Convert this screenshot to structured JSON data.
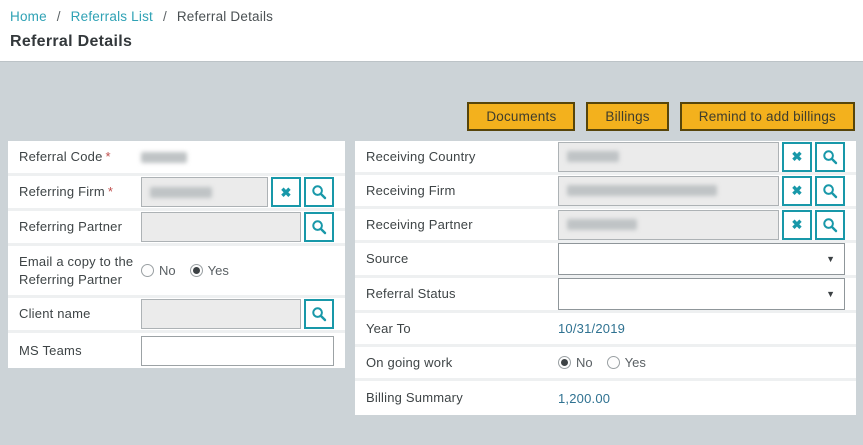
{
  "breadcrumb": {
    "separator": "/",
    "items": [
      {
        "label": "Home",
        "link": true
      },
      {
        "label": "Referrals List",
        "link": true
      },
      {
        "label": "Referral Details",
        "link": false
      }
    ]
  },
  "page": {
    "title": "Referral Details"
  },
  "toolbar": {
    "buttons": [
      {
        "label": "Documents"
      },
      {
        "label": "Billings"
      },
      {
        "label": "Remind to add billings"
      }
    ]
  },
  "marks": {
    "required": "*"
  },
  "icons": {
    "clear": "✖",
    "search": "magnifier",
    "dropdown": "▼"
  },
  "colors": {
    "accent_teal": "#1898a9",
    "link_teal": "#2fa2b5",
    "button_yellow": "#f3b11d",
    "value_blue": "#2f7291",
    "required_red": "#be4b49",
    "page_background": "#ccd3d7"
  },
  "form_left": {
    "fields": [
      {
        "label": "Referral Code",
        "required": true,
        "value": "",
        "value_obscured": true,
        "type": "readonly"
      },
      {
        "label": "Referring Firm",
        "required": true,
        "value": "",
        "value_obscured": true,
        "type": "lookup",
        "actions": [
          "clear",
          "search"
        ]
      },
      {
        "label": "Referring Partner",
        "value": "",
        "value_obscured": false,
        "type": "lookup",
        "actions": [
          "search"
        ]
      },
      {
        "label": "Email a copy to the Referring Partner",
        "type": "radio",
        "options": [
          "No",
          "Yes"
        ],
        "selected": "Yes"
      },
      {
        "label": "Client name",
        "value": "",
        "value_obscured": false,
        "type": "lookup",
        "actions": [
          "search"
        ]
      },
      {
        "label": "MS Teams",
        "value": "",
        "type": "text"
      }
    ]
  },
  "form_right": {
    "fields": [
      {
        "label": "Receiving Country",
        "value": "",
        "value_obscured": true,
        "type": "lookup",
        "actions": [
          "clear",
          "search"
        ]
      },
      {
        "label": "Receiving Firm",
        "value": "",
        "value_obscured": true,
        "type": "lookup",
        "actions": [
          "clear",
          "search"
        ]
      },
      {
        "label": "Receiving Partner",
        "value": "",
        "value_obscured": true,
        "type": "lookup",
        "actions": [
          "clear",
          "search"
        ]
      },
      {
        "label": "Source",
        "value": "",
        "type": "select"
      },
      {
        "label": "Referral Status",
        "value": "",
        "type": "select"
      },
      {
        "label": "Year To",
        "value": "10/31/2019",
        "type": "readonly"
      },
      {
        "label": "On going work",
        "type": "radio",
        "options": [
          "No",
          "Yes"
        ],
        "selected": "No"
      },
      {
        "label": "Billing Summary",
        "value": "1,200.00",
        "type": "readonly"
      }
    ]
  }
}
